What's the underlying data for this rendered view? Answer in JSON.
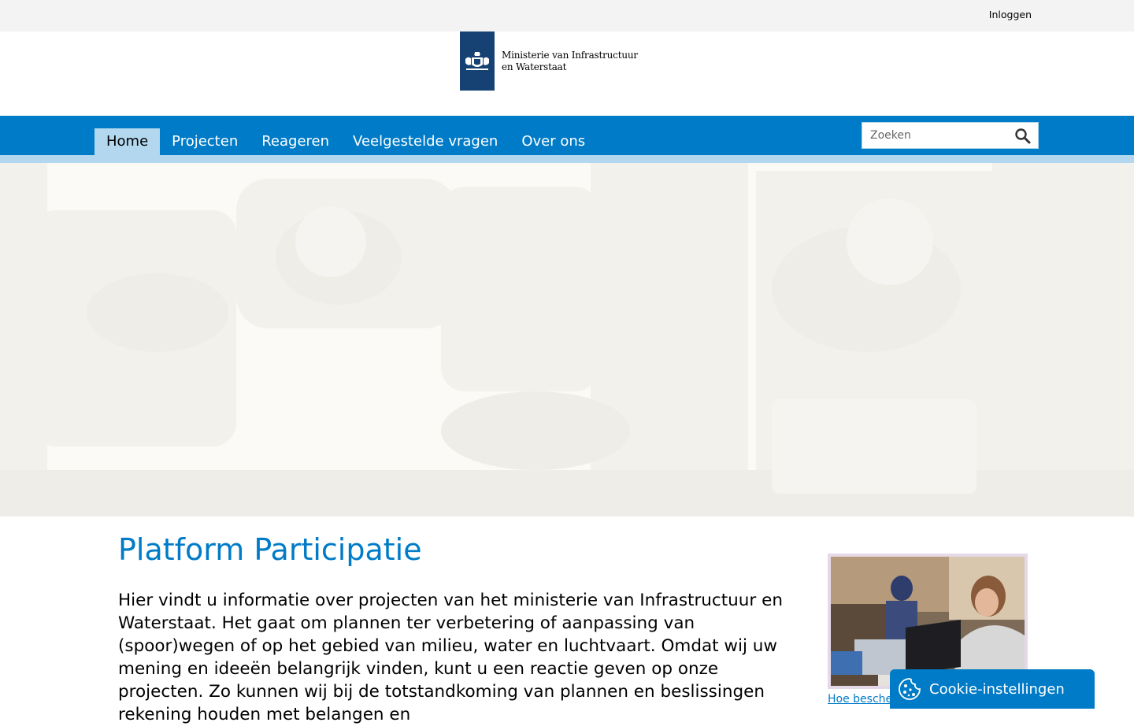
{
  "topbar": {
    "login_label": "Inloggen"
  },
  "logo": {
    "line1": "Ministerie van Infrastructuur",
    "line2": "en Waterstaat"
  },
  "nav": {
    "items": [
      {
        "label": "Home",
        "active": true
      },
      {
        "label": "Projecten"
      },
      {
        "label": "Reageren"
      },
      {
        "label": "Veelgestelde vragen"
      },
      {
        "label": "Over ons"
      }
    ]
  },
  "search": {
    "placeholder": "Zoeken",
    "value": ""
  },
  "main": {
    "title": "Platform Participatie",
    "intro": "Hier vindt u informatie over projecten van het ministerie van Infrastructuur en Waterstaat. Het gaat om plannen ter verbetering of aanpassing van (spoor)wegen of op het gebied van milieu, water en luchtvaart. Omdat wij uw mening en ideeën belangrijk vinden, kunt u een reactie geven op onze projecten. Zo kunnen wij bij de totstandkoming van plannen en beslissingen rekening houden met belangen en"
  },
  "sidebar": {
    "link_label": "Hoe bescher"
  },
  "cookie": {
    "label": "Cookie-instellingen"
  },
  "colors": {
    "brand_blue": "#007bc7",
    "nav_light": "#b2d7ee",
    "logo_blue": "#154273",
    "topbar_bg": "#f3f3f3"
  }
}
